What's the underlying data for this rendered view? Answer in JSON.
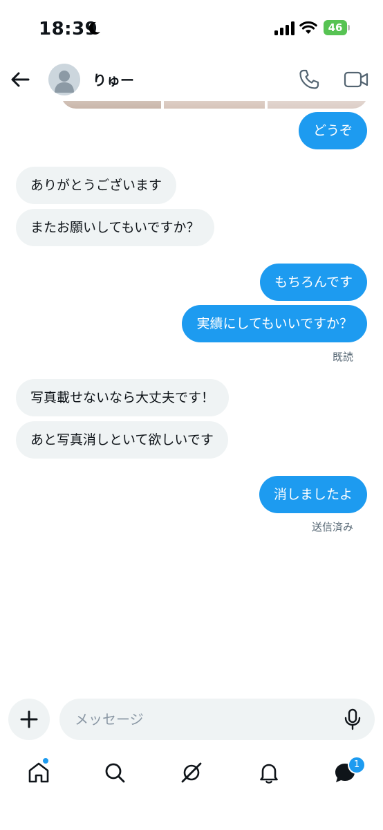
{
  "status_bar": {
    "time": "18:39",
    "battery": "46"
  },
  "header": {
    "contact_name": "りゅー"
  },
  "messages": [
    {
      "side": "sent",
      "text": "どうぞ"
    },
    {
      "side": "received",
      "text": "ありがとうございます"
    },
    {
      "side": "received",
      "text": "またお願いしてもいですか？"
    },
    {
      "side": "sent",
      "text": "もちろんです"
    },
    {
      "side": "sent",
      "text": "実績にしてもいいですか？"
    },
    {
      "side": "received",
      "text": "写真載せないなら大丈夫です！"
    },
    {
      "side": "received",
      "text": "あと写真消しといて欲しいです"
    },
    {
      "side": "sent",
      "text": "消しましたよ"
    }
  ],
  "receipts": {
    "read": "既読",
    "sent": "送信済み"
  },
  "composer": {
    "placeholder": "メッセージ"
  },
  "nav": {
    "messages_badge": "1",
    "icons": [
      "home-icon",
      "search-icon",
      "grok-icon",
      "bell-icon",
      "messages-icon"
    ]
  },
  "colors": {
    "accent": "#1d9bf0",
    "received_bubble": "#eff3f4",
    "battery": "#57c353"
  }
}
